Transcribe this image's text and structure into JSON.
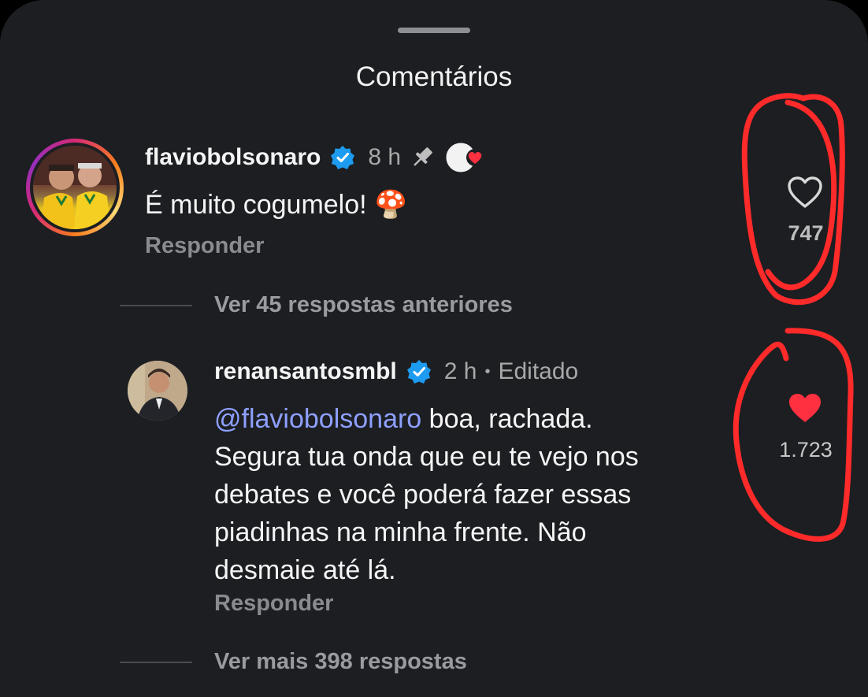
{
  "sheet": {
    "title": "Comentários"
  },
  "comments": [
    {
      "username": "flaviobolsonaro",
      "time": "8 h",
      "text": "É muito cogumelo! 🍄",
      "reply_label": "Responder",
      "likes": "747",
      "liked": false,
      "pinned": true,
      "creator_liked": true
    },
    {
      "username": "renansantosmbl",
      "time": "2 h",
      "separator": "•",
      "edited_label": "Editado",
      "mention": "@flaviobolsonaro",
      "text_line1": " boa, rachada.",
      "text_rest": [
        "Segura tua onda que eu te vejo nos",
        "debates e você poderá fazer essas",
        "piadinhas na minha frente. Não",
        "desmaie até lá."
      ],
      "reply_label": "Responder",
      "likes": "1.723",
      "liked": true
    }
  ],
  "threads": {
    "previous_replies": "Ver 45 respostas anteriores",
    "more_replies": "Ver mais 398 respostas"
  },
  "colors": {
    "background": "#1c1e22",
    "verified": "#1d9bf0",
    "like_red": "#ff3040",
    "mention": "#8ea0ff",
    "annotation_red": "#ff2a2a"
  }
}
